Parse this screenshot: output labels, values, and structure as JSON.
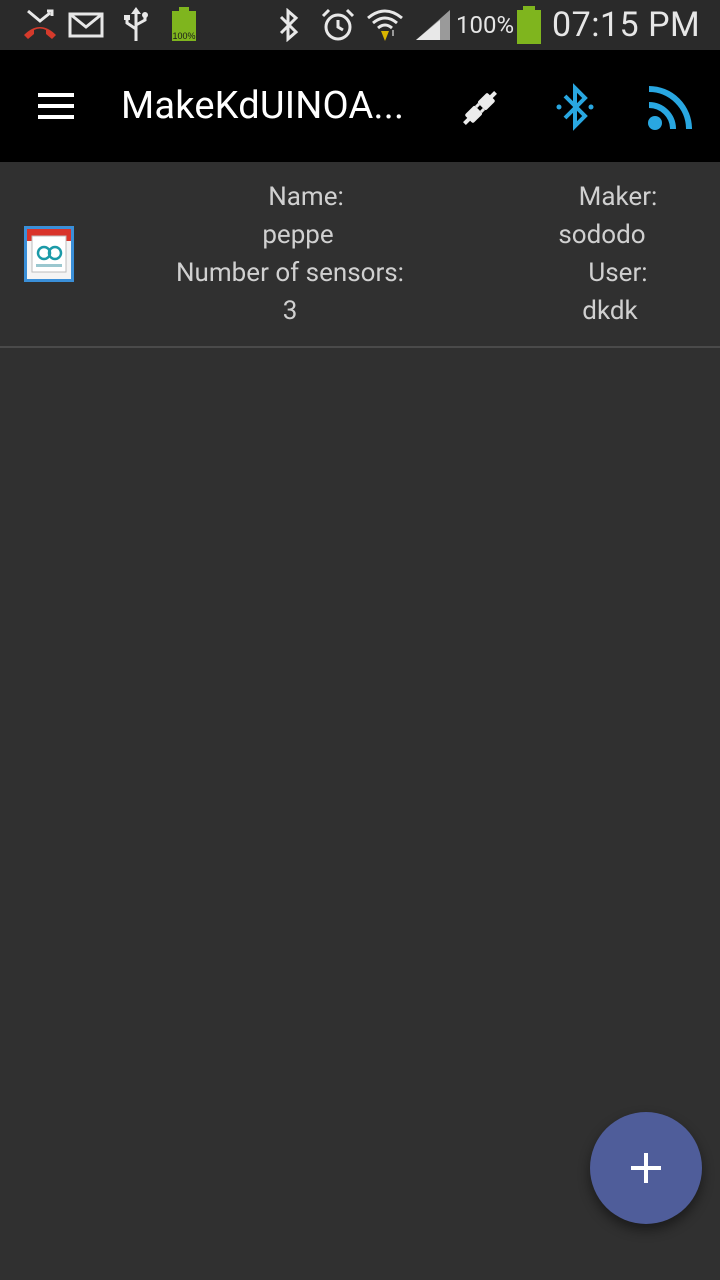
{
  "status_bar": {
    "left_icons": [
      "missed-call-icon",
      "mail-icon",
      "usb-icon",
      "battery-widget-icon"
    ],
    "battery_widget_label": "100%",
    "right_icons": [
      "bluetooth-icon",
      "alarm-icon",
      "wifi-icon",
      "signal-icon",
      "battery-icon"
    ],
    "battery_percent": "100%",
    "time": "07:15 PM"
  },
  "toolbar": {
    "title": "MakeKdUINOA...",
    "actions": [
      "plug-icon",
      "bluetooth-icon",
      "wifi-feed-icon"
    ],
    "accent_color": "#29a7e1"
  },
  "device": {
    "icon": "arduino-app-icon",
    "name_label": "Name:",
    "name_value": "peppe",
    "sensors_label": "Number of sensors:",
    "sensors_value": "3",
    "maker_label": "Maker:",
    "maker_value": "sododo",
    "user_label": "User:",
    "user_value": "dkdk"
  },
  "fab": {
    "icon": "plus-icon",
    "color": "#4f5d9a"
  }
}
